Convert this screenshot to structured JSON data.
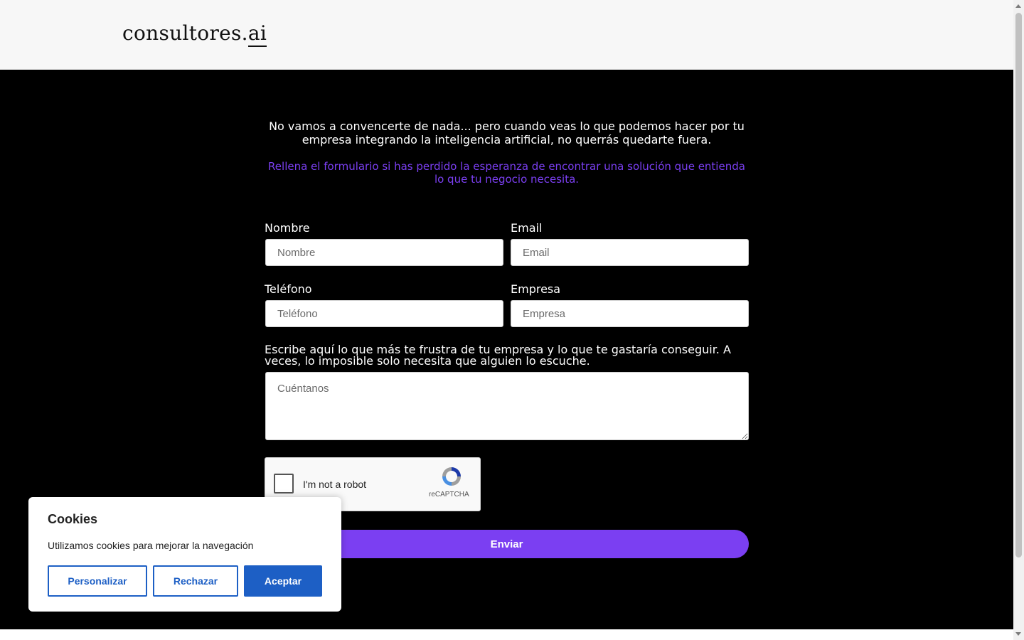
{
  "header": {
    "logo_main": "consultores.",
    "logo_suffix": "ai"
  },
  "intro": {
    "text": "No vamos a convencerte de nada... pero cuando veas lo que podemos hacer por tu empresa integrando la inteligencia artificial, no querrás quedarte fuera.",
    "subtext": "Rellena el formulario si has perdido la esperanza de encontrar una solución que entienda lo que tu negocio necesita."
  },
  "form": {
    "nombre": {
      "label": "Nombre",
      "placeholder": "Nombre",
      "value": ""
    },
    "email": {
      "label": "Email",
      "placeholder": "Email",
      "value": ""
    },
    "telefono": {
      "label": "Teléfono",
      "placeholder": "Teléfono",
      "value": ""
    },
    "empresa": {
      "label": "Empresa",
      "placeholder": "Empresa",
      "value": ""
    },
    "mensaje": {
      "label": "Escribe aquí lo que más te frustra de tu empresa y lo que te gastaría conseguir. A veces, lo imposible solo necesita que alguien lo escuche.",
      "placeholder": "Cuéntanos",
      "value": ""
    },
    "recaptcha": {
      "label": "I'm not a robot",
      "brand": "reCAPTCHA"
    },
    "submit_label": "Enviar"
  },
  "cookies": {
    "title": "Cookies",
    "text": "Utilizamos cookies para mejorar la navegación",
    "customize_label": "Personalizar",
    "reject_label": "Rechazar",
    "accept_label": "Aceptar"
  },
  "colors": {
    "accent": "#7b3ff2",
    "cookie_button": "#1d5fc5"
  }
}
